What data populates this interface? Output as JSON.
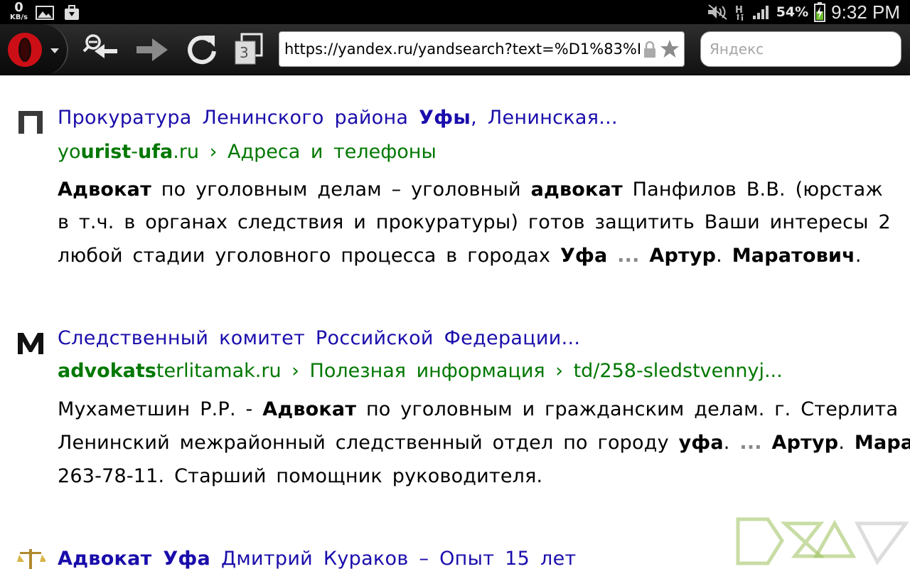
{
  "status_bar": {
    "speed_value": "0",
    "speed_unit": "KB/s",
    "battery_percent": "54%",
    "time": "9:32 PM"
  },
  "toolbar": {
    "tab_count": "3",
    "url": "https://yandex.ru/yandsearch?text=%D1%83%D",
    "search_placeholder": "Яндекс"
  },
  "results": [
    {
      "favicon_letter": "П",
      "title": [
        {
          "t": "Прокуратура Ленинского района ",
          "b": false
        },
        {
          "t": "Уфы",
          "b": true
        },
        {
          "t": ", Ленинская...",
          "b": false
        }
      ],
      "url": [
        {
          "t": "yo",
          "b": false
        },
        {
          "t": "urist",
          "b": true
        },
        {
          "t": "-",
          "b": false
        },
        {
          "t": "ufa",
          "b": true
        },
        {
          "t": ".ru › Адреса и телефоны",
          "b": false
        }
      ],
      "snippet_lines": [
        [
          {
            "t": "Адвокат",
            "b": true
          },
          {
            "t": " по уголовным делам – уголовный ",
            "b": false
          },
          {
            "t": "адвокат",
            "b": true
          },
          {
            "t": " Панфилов В.В. (юрстаж",
            "b": false
          }
        ],
        [
          {
            "t": "в т.ч. в органах следствия и прокуратуры) готов защитить Ваши интересы 2",
            "b": false
          }
        ],
        [
          {
            "t": "любой стадии уголовного процесса в городах ",
            "b": false
          },
          {
            "t": "Уфа",
            "b": true
          },
          {
            "t": " ",
            "b": false
          },
          {
            "t": "...",
            "e": true
          },
          {
            "t": " ",
            "b": false
          },
          {
            "t": "Артур",
            "b": true
          },
          {
            "t": ". ",
            "b": false
          },
          {
            "t": "Маратович",
            "b": true
          },
          {
            "t": ".",
            "b": false
          }
        ]
      ]
    },
    {
      "favicon_letter": "М",
      "title": [
        {
          "t": "Следственный комитет Российской Федерации...",
          "b": false
        }
      ],
      "url": [
        {
          "t": "advokats",
          "b": true
        },
        {
          "t": "terlitamak.ru › Полезная информация › td/258-sledstvennyj...",
          "b": false
        }
      ],
      "snippet_lines": [
        [
          {
            "t": "Мухаметшин Р.Р. - ",
            "b": false
          },
          {
            "t": "Адвокат",
            "b": true
          },
          {
            "t": " по уголовным и гражданским делам. г. Стерлита",
            "b": false
          }
        ],
        [
          {
            "t": "Ленинский межрайонный следственный отдел по городу ",
            "b": false
          },
          {
            "t": "уфа",
            "b": true
          },
          {
            "t": ". ",
            "b": false
          },
          {
            "t": "...",
            "e": true
          },
          {
            "t": " ",
            "b": false
          },
          {
            "t": "Артур",
            "b": true
          },
          {
            "t": ". ",
            "b": false
          },
          {
            "t": "Мара",
            "b": true
          }
        ],
        [
          {
            "t": "263-78-11. Старший помощник руководителя.",
            "b": false
          }
        ]
      ]
    },
    {
      "favicon_letter": "",
      "title": [
        {
          "t": "Адвокат Уфа",
          "b": true
        },
        {
          "t": " Дмитрий Кураков – Опыт 15 лет",
          "b": false
        }
      ]
    }
  ],
  "colors": {
    "link": "#1a0dab",
    "url_green": "#007700",
    "opera_red": "#cc0f16"
  }
}
